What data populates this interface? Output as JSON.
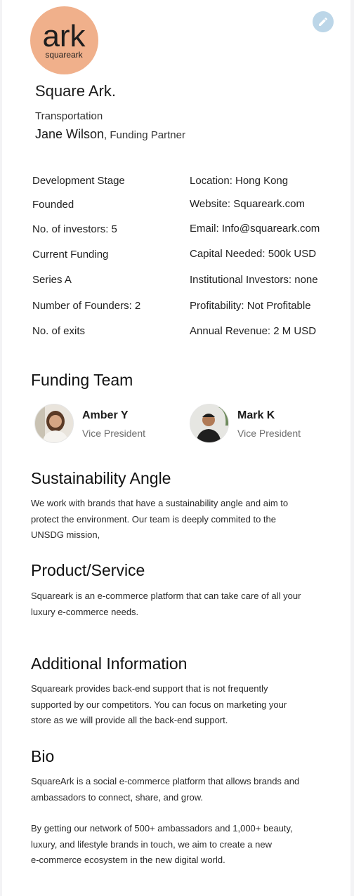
{
  "company": {
    "logo_main_text": "ark",
    "logo_sub_text": "squareark",
    "name": "Square Ark.",
    "industry": "Transportation",
    "contact_name": "Jane Wilson",
    "contact_role": ", Funding Partner"
  },
  "details": {
    "left": [
      "Development Stage",
      "Founded",
      "No. of investors: 5",
      "Current Funding",
      "Series A",
      "Number of Founders: 2",
      "No. of exits"
    ],
    "right": [
      "Location: Hong Kong",
      "Website: Squareark.com",
      "Email: Info@squareark.com",
      "Capital Needed: 500k USD",
      "Institutional Investors: none",
      "Profitability: Not Profitable",
      "Annual Revenue: 2 M USD"
    ]
  },
  "funding_team": {
    "title": "Funding Team",
    "members": [
      {
        "name": "Amber Y",
        "role": "Vice President"
      },
      {
        "name": "Mark K",
        "role": "Vice President"
      }
    ]
  },
  "sustainability": {
    "title": "Sustainability Angle",
    "lines": [
      "We work with brands that have a sustainability angle and aim to",
      "protect the environment. Our team is deeply commited to the",
      "UNSDG mission,"
    ]
  },
  "product": {
    "title": "Product/Service",
    "lines": [
      "Squareark is an e-commerce platform that can take care of all your",
      "luxury e-commerce needs."
    ]
  },
  "additional": {
    "title": "Additional Information",
    "lines": [
      "Squareark provides back-end support that is not frequently",
      "supported by our competitors. You can focus on marketing your",
      "store as we will provide all the back-end support."
    ]
  },
  "bio": {
    "title": "Bio",
    "para1_lines": [
      "SquareArk is a social e-commerce platform that allows brands and",
      "ambassadors to connect, share, and grow."
    ],
    "para2_lines": [
      "By getting our network of 500+ ambassadors and 1,000+ beauty,",
      "luxury, and lifestyle brands in touch, we aim to create a new",
      "e-commerce ecosystem in the new digital world."
    ]
  },
  "colors": {
    "logo_bg": "#f0b08b",
    "edit_button_bg": "#bcd6e8"
  },
  "icons": {
    "edit": "pencil-icon"
  }
}
